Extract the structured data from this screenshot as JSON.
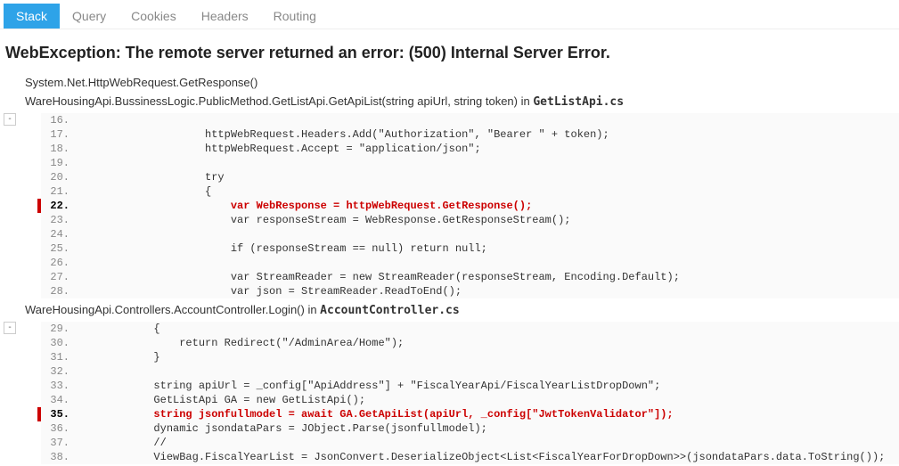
{
  "tabs": {
    "stack": "Stack",
    "query": "Query",
    "cookies": "Cookies",
    "headers": "Headers",
    "routing": "Routing"
  },
  "exception_title": "WebException: The remote server returned an error: (500) Internal Server Error.",
  "collapse_glyph": "-",
  "frames": [
    {
      "text": "System.Net.HttpWebRequest.GetResponse()",
      "file": "",
      "code": null
    },
    {
      "text": "WareHousingApi.BussinessLogic.PublicMethod.GetListApi.GetApiList(string apiUrl, string token) in ",
      "file": "GetListApi.cs",
      "code": {
        "error_line": 22,
        "lines": [
          {
            "n": 16,
            "t": ""
          },
          {
            "n": 17,
            "t": "                    httpWebRequest.Headers.Add(\"Authorization\", \"Bearer \" + token);"
          },
          {
            "n": 18,
            "t": "                    httpWebRequest.Accept = \"application/json\";"
          },
          {
            "n": 19,
            "t": ""
          },
          {
            "n": 20,
            "t": "                    try"
          },
          {
            "n": 21,
            "t": "                    {"
          },
          {
            "n": 22,
            "t": "                        var WebResponse = httpWebRequest.GetResponse();"
          },
          {
            "n": 23,
            "t": "                        var responseStream = WebResponse.GetResponseStream();"
          },
          {
            "n": 24,
            "t": ""
          },
          {
            "n": 25,
            "t": "                        if (responseStream == null) return null;"
          },
          {
            "n": 26,
            "t": ""
          },
          {
            "n": 27,
            "t": "                        var StreamReader = new StreamReader(responseStream, Encoding.Default);"
          },
          {
            "n": 28,
            "t": "                        var json = StreamReader.ReadToEnd();"
          }
        ]
      }
    },
    {
      "text": "WareHousingApi.Controllers.AccountController.Login() in ",
      "file": "AccountController.cs",
      "code": {
        "error_line": 35,
        "lines": [
          {
            "n": 29,
            "t": "            {"
          },
          {
            "n": 30,
            "t": "                return Redirect(\"/AdminArea/Home\");"
          },
          {
            "n": 31,
            "t": "            }"
          },
          {
            "n": 32,
            "t": ""
          },
          {
            "n": 33,
            "t": "            string apiUrl = _config[\"ApiAddress\"] + \"FiscalYearApi/FiscalYearListDropDown\";"
          },
          {
            "n": 34,
            "t": "            GetListApi GA = new GetListApi();"
          },
          {
            "n": 35,
            "t": "            string jsonfullmodel = await GA.GetApiList(apiUrl, _config[\"JwtTokenValidator\"]);"
          },
          {
            "n": 36,
            "t": "            dynamic jsondataPars = JObject.Parse(jsonfullmodel);"
          },
          {
            "n": 37,
            "t": "            //"
          },
          {
            "n": 38,
            "t": "            ViewBag.FiscalYearList = JsonConvert.DeserializeObject<List<FiscalYearForDropDown>>(jsondataPars.data.ToString());"
          }
        ]
      }
    }
  ]
}
